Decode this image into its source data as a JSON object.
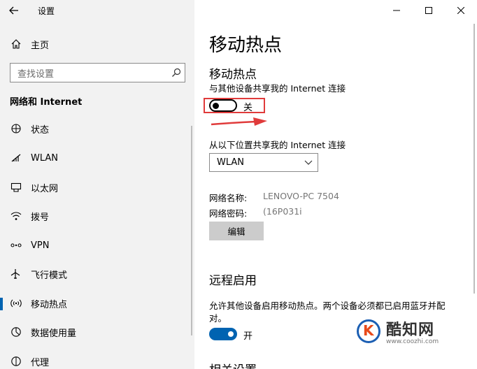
{
  "window": {
    "title": "设置"
  },
  "sidebar": {
    "home_label": "主页",
    "search_placeholder": "查找设置",
    "section_title": "网络和 Internet",
    "items": [
      {
        "label": "状态",
        "icon": "status-icon"
      },
      {
        "label": "WLAN",
        "icon": "wifi-icon"
      },
      {
        "label": "以太网",
        "icon": "ethernet-icon"
      },
      {
        "label": "拨号",
        "icon": "dialup-icon"
      },
      {
        "label": "VPN",
        "icon": "vpn-icon"
      },
      {
        "label": "飞行模式",
        "icon": "airplane-icon"
      },
      {
        "label": "移动热点",
        "icon": "hotspot-icon",
        "selected": true
      },
      {
        "label": "数据使用量",
        "icon": "data-usage-icon"
      },
      {
        "label": "代理",
        "icon": "proxy-icon"
      }
    ]
  },
  "main": {
    "page_title": "移动热点",
    "hotspot": {
      "title": "移动热点",
      "description": "与其他设备共享我的 Internet 连接",
      "toggle_state": "off",
      "toggle_label": "关"
    },
    "share_from": {
      "label": "从以下位置共享我的 Internet 连接",
      "selected": "WLAN"
    },
    "network": {
      "name_label": "网络名称:",
      "name_value": "LENOVO-PC 7504",
      "password_label": "网络密码:",
      "password_value": "(16P031i",
      "edit_button": "编辑"
    },
    "remote": {
      "title": "远程启用",
      "description": "允许其他设备启用移动热点。两个设备必须都已启用蓝牙并配对。",
      "toggle_state": "on",
      "toggle_label": "开"
    },
    "related_title": "相关设置"
  },
  "watermark": {
    "brand": "酷知网",
    "url": "www.coozhi.com"
  },
  "colors": {
    "accent": "#0063b1",
    "highlight_box": "#e03b3b",
    "sidebar_bg": "#f2f2f2"
  }
}
